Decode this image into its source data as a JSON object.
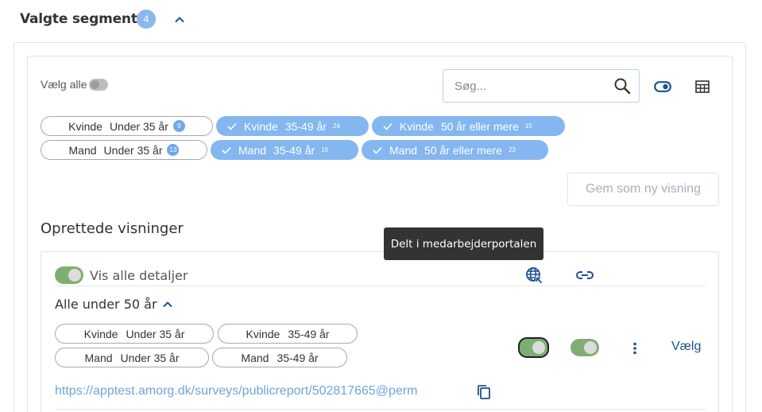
{
  "header": {
    "title": "Valgte segmenter",
    "count": "4"
  },
  "filters": {
    "select_all_label": "Vælg alle",
    "search_placeholder": "Søg...",
    "chips": [
      {
        "gender": "Kvinde",
        "age": "Under 35 år",
        "count": "9",
        "selected": false
      },
      {
        "gender": "Kvinde",
        "age": "35-49 år",
        "count": "24",
        "selected": true
      },
      {
        "gender": "Kvinde",
        "age": "50 år eller mere",
        "count": "15",
        "selected": true
      },
      {
        "gender": "Mand",
        "age": "Under 35 år",
        "count": "13",
        "selected": false
      },
      {
        "gender": "Mand",
        "age": "35-49 år",
        "count": "16",
        "selected": true
      },
      {
        "gender": "Mand",
        "age": "50 år eller mere",
        "count": "23",
        "selected": true
      }
    ],
    "save_view_label": "Gem som ny visning"
  },
  "views": {
    "section_title": "Oprettede visninger",
    "tooltip": "Delt i medarbejderportalen",
    "show_details_label": "Vis alle detaljer",
    "items": [
      {
        "name": "Alle under 50 år",
        "chips": [
          {
            "gender": "Kvinde",
            "age": "Under 35 år"
          },
          {
            "gender": "Kvinde",
            "age": "35-49 år"
          },
          {
            "gender": "Mand",
            "age": "Under 35 år"
          },
          {
            "gender": "Mand",
            "age": "35-49 år"
          }
        ],
        "select_label": "Vælg",
        "url": "https://apptest.amorg.dk/surveys/publicreport/502817665@perm"
      }
    ]
  },
  "colors": {
    "accent": "#84b6ef",
    "toggle_on": "#7fae72",
    "link": "#6fa4dc",
    "dark_link": "#1a5292"
  },
  "icons": [
    "chevron-up-icon",
    "search-icon",
    "toggle-view-icon",
    "table-icon",
    "check-icon",
    "globe-icon",
    "link-icon",
    "more-vertical-icon",
    "copy-icon"
  ]
}
